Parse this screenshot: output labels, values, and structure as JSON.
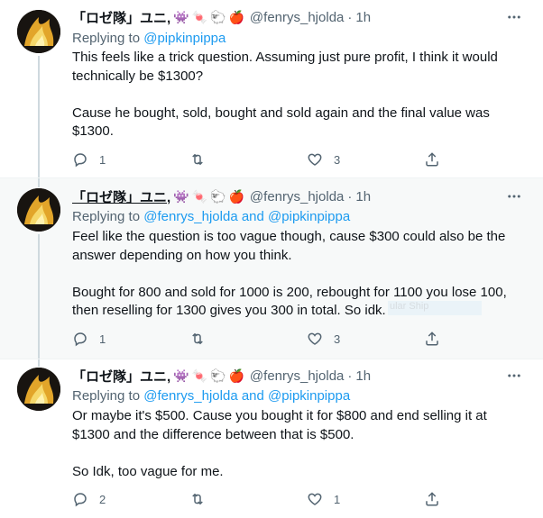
{
  "tweets": [
    {
      "display_name": "「ロゼ隊」ユニ,",
      "emojis": [
        "👾",
        "🍬",
        "🐑",
        "🍎"
      ],
      "handle": "@fenrys_hjolda",
      "separator": "·",
      "time": "1h",
      "reply_prefix": "Replying to",
      "reply_mentions": [
        "@pipkinpippa"
      ],
      "reply_joiner": "",
      "paragraphs": [
        "This feels like a trick question. Assuming just pure profit, I think it would technically be $1300?",
        "Cause he bought, sold, bought and sold again and the final value was $1300."
      ],
      "reply_count": "1",
      "retweet_count": "",
      "like_count": "3"
    },
    {
      "display_name": "「ロゼ隊」ユニ,",
      "emojis": [
        "👾",
        "🍬",
        "🐑",
        "🍎"
      ],
      "handle": "@fenrys_hjolda",
      "separator": "·",
      "time": "1h",
      "reply_prefix": "Replying to",
      "reply_mentions": [
        "@fenrys_hjolda",
        "@pipkinpippa"
      ],
      "reply_joiner": "and",
      "paragraphs": [
        "Feel like the question is too vague though, cause $300 could also be the answer depending on how you think.",
        "Bought for 800 and sold for 1000 is 200, rebought for 1100 you lose 100, then reselling for 1300 gives you 300 in total. So idk."
      ],
      "reply_count": "1",
      "retweet_count": "",
      "like_count": "3",
      "ghost_text": "ular Ship"
    },
    {
      "display_name": "「ロゼ隊」ユニ,",
      "emojis": [
        "👾",
        "🍬",
        "🐑",
        "🍎"
      ],
      "handle": "@fenrys_hjolda",
      "separator": "·",
      "time": "1h",
      "reply_prefix": "Replying to",
      "reply_mentions": [
        "@fenrys_hjolda",
        "@pipkinpippa"
      ],
      "reply_joiner": "and",
      "paragraphs": [
        "Or maybe it's $500. Cause you bought it for $800 and end selling it at $1300 and the difference between that is $500.",
        "So Idk, too vague for me."
      ],
      "reply_count": "2",
      "retweet_count": "",
      "like_count": "1"
    }
  ],
  "icons": {
    "more": "more-horizontal-icon",
    "reply": "reply-bubble-icon",
    "retweet": "retweet-icon",
    "like": "heart-icon",
    "share": "share-upload-icon"
  },
  "colors": {
    "link": "#1d9bf0",
    "secondary_text": "#536471",
    "primary_text": "#0f1419",
    "thread_line": "#cfd9de",
    "hover_background": "#f7f9f9"
  }
}
